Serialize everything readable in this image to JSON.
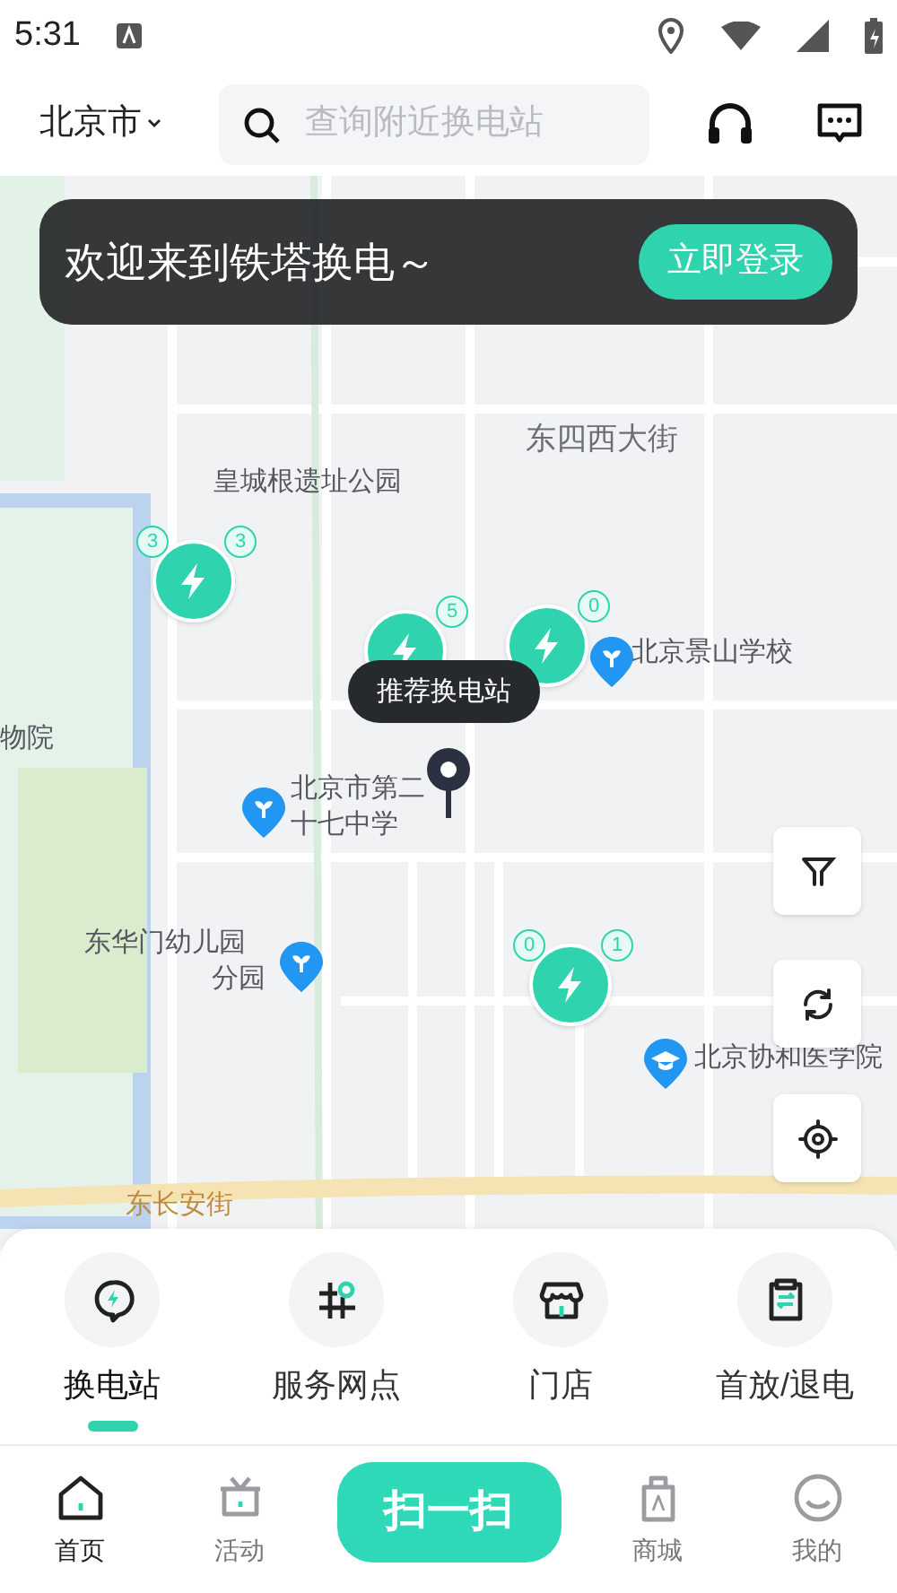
{
  "status_bar": {
    "time": "5:31"
  },
  "header": {
    "city": "北京市",
    "search": {
      "placeholder": "查询附近换电站"
    }
  },
  "banner": {
    "text": "欢迎来到铁塔换电～",
    "button": "立即登录"
  },
  "map": {
    "labels": [
      {
        "text": "东四西大街",
        "kind": "road"
      },
      {
        "text": "皇城根遗址公园",
        "kind": "place"
      },
      {
        "text": "北京景山学校",
        "kind": "poi"
      },
      {
        "text": "北京市第二",
        "kind": "poi"
      },
      {
        "text": "十七中学",
        "kind": "place"
      },
      {
        "text": "东华门幼儿园",
        "kind": "place"
      },
      {
        "text": "分园",
        "kind": "poi"
      },
      {
        "text": "北京协和医学院",
        "kind": "school"
      },
      {
        "text": "物院",
        "kind": "place"
      },
      {
        "text": "东长安街",
        "kind": "avenue"
      }
    ],
    "stations": [
      {
        "counts": [
          "3",
          "3"
        ]
      },
      {
        "counts": [
          "5"
        ]
      },
      {
        "counts": [
          "0"
        ]
      },
      {
        "counts": [
          "0",
          "1"
        ]
      }
    ],
    "tooltip": "推荐换电站"
  },
  "categories": [
    {
      "label": "换电站",
      "selected": true
    },
    {
      "label": "服务网点",
      "selected": false
    },
    {
      "label": "门店",
      "selected": false
    },
    {
      "label": "首放/退电",
      "selected": false
    }
  ],
  "nav": [
    {
      "label": "首页",
      "kind": "tab",
      "selected": true
    },
    {
      "label": "活动",
      "kind": "tab",
      "selected": false
    },
    {
      "label": "扫一扫",
      "kind": "scan",
      "selected": false
    },
    {
      "label": "商城",
      "kind": "tab",
      "selected": false
    },
    {
      "label": "我的",
      "kind": "tab",
      "selected": false
    }
  ]
}
